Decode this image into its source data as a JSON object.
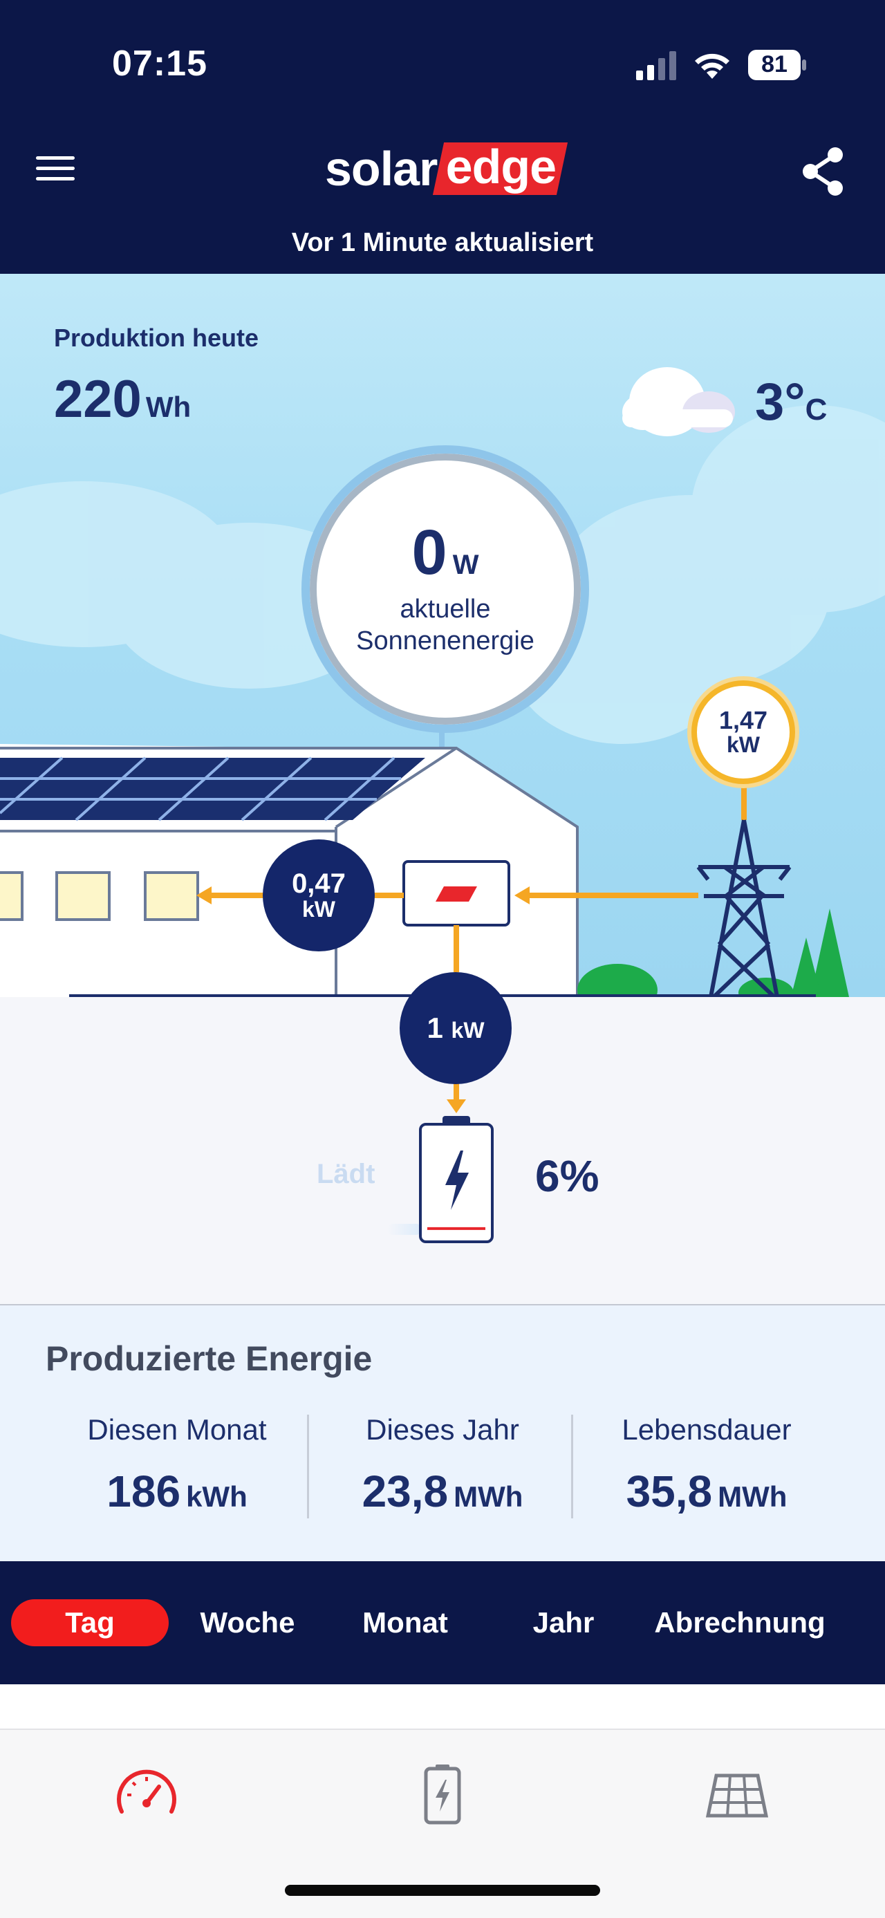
{
  "status_bar": {
    "time": "07:15",
    "battery_level": "81"
  },
  "header": {
    "logo_part1": "solar",
    "logo_part2": "edge",
    "updated_text": "Vor 1 Minute aktualisiert",
    "menu_icon": "hamburger-menu-icon",
    "share_icon": "share-icon"
  },
  "production_today": {
    "label": "Produktion heute",
    "value": "220",
    "unit": "Wh"
  },
  "weather": {
    "temperature": "3°",
    "unit": "C",
    "icon": "cloud-icon"
  },
  "solar": {
    "value": "0",
    "unit": "W",
    "label_line1": "aktuelle",
    "label_line2": "Sonnenenergie"
  },
  "grid": {
    "value": "1,47",
    "unit": "kW"
  },
  "home_consumption": {
    "value": "0,47",
    "unit": "kW"
  },
  "battery": {
    "flow_value": "1",
    "flow_unit": "kW",
    "status": "Lädt",
    "percent": "6%",
    "level_fraction": 0.06
  },
  "produced_energy": {
    "title": "Produzierte Energie",
    "stats": [
      {
        "label": "Diesen Monat",
        "value": "186",
        "unit": "kWh"
      },
      {
        "label": "Dieses Jahr",
        "value": "23,8",
        "unit": "MWh"
      },
      {
        "label": "Lebensdauer",
        "value": "35,8",
        "unit": "MWh"
      }
    ]
  },
  "period_tabs": [
    {
      "label": "Tag",
      "active": true
    },
    {
      "label": "Woche",
      "active": false
    },
    {
      "label": "Monat",
      "active": false
    },
    {
      "label": "Jahr",
      "active": false
    },
    {
      "label": "Abrechnung",
      "active": false
    }
  ],
  "bottom_nav": [
    {
      "icon": "dashboard-gauge-icon",
      "active": true
    },
    {
      "icon": "battery-icon",
      "active": false
    },
    {
      "icon": "solar-panel-layout-icon",
      "active": false
    }
  ],
  "colors": {
    "navy": "#0c1748",
    "accent_red": "#f21d1d",
    "flow_orange": "#f5a623",
    "text_blue": "#1c2e6b"
  }
}
